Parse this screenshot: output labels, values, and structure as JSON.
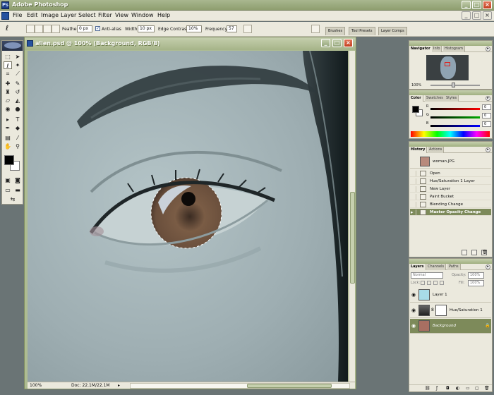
{
  "window": {
    "title": "Adobe Photoshop",
    "minimize": "_",
    "maximize": "□",
    "close": "×"
  },
  "menu": [
    "File",
    "Edit",
    "Image",
    "Layer",
    "Select",
    "Filter",
    "View",
    "Window",
    "Help"
  ],
  "options": {
    "feather_label": "Feather:",
    "feather_value": "0 px",
    "antialias_label": "Anti-alias",
    "width_label": "Width:",
    "width_value": "10 px",
    "edge_contrast_label": "Edge Contrast:",
    "edge_contrast_value": "10%",
    "frequency_label": "Frequency:",
    "frequency_value": "57",
    "well_tabs": [
      "Brushes",
      "Tool Presets",
      "Layer Comps"
    ]
  },
  "document": {
    "title": "alien.psd @ 100% (Background, RGB/8)",
    "zoom": "100%",
    "doc_size": "Doc: 22.1M/22.1M"
  },
  "navigator": {
    "tabs": [
      "Navigator",
      "Info",
      "Histogram"
    ],
    "zoom": "100%"
  },
  "color": {
    "tabs": [
      "Color",
      "Swatches",
      "Styles"
    ],
    "channels": [
      {
        "label": "R",
        "value": "0"
      },
      {
        "label": "G",
        "value": "0"
      },
      {
        "label": "B",
        "value": "0"
      }
    ]
  },
  "history": {
    "tabs": [
      "History",
      "Actions"
    ],
    "snapshot": "woman.JPG",
    "items": [
      "Open",
      "Hue/Saturation 1 Layer",
      "New Layer",
      "Paint Bucket",
      "Blending Change",
      "Master Opacity Change"
    ]
  },
  "layers": {
    "tabs": [
      "Layers",
      "Channels",
      "Paths"
    ],
    "blend_mode": "Normal",
    "opacity_label": "Opacity:",
    "opacity_value": "100%",
    "lock_label": "Lock:",
    "fill_label": "Fill:",
    "fill_value": "100%",
    "items": [
      "Layer 1",
      "Hue/Saturation 1",
      "Background"
    ]
  },
  "colors": {
    "titlebar": "#8e9e6f",
    "accent": "#7d8a5a",
    "workspace": "#6a7475"
  }
}
